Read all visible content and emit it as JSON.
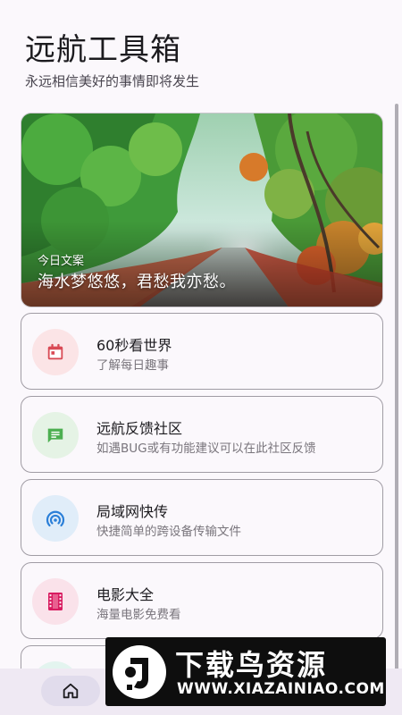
{
  "header": {
    "title": "远航工具箱",
    "subtitle": "永远相信美好的事情即将发生"
  },
  "hero": {
    "label": "今日文案",
    "quote": "海水梦悠悠，君愁我亦愁。"
  },
  "cards": [
    {
      "title": "60秒看世界",
      "desc": "了解每日趣事",
      "icon": "calendar-icon",
      "icon_color": "#d94a55",
      "icon_bg": "#fbe4e6"
    },
    {
      "title": "远航反馈社区",
      "desc": "如遇BUG或有功能建议可以在此社区反馈",
      "icon": "chat-message-icon",
      "icon_color": "#4caf50",
      "icon_bg": "#e5f3e5"
    },
    {
      "title": "局域网快传",
      "desc": "快捷简单的跨设备传输文件",
      "icon": "wifi-tethering-icon",
      "icon_color": "#2b7fd8",
      "icon_bg": "#e0edf9"
    },
    {
      "title": "电影大全",
      "desc": "海量电影免费看",
      "icon": "film-icon",
      "icon_color": "#d81b60",
      "icon_bg": "#fae2ea"
    }
  ],
  "nav": {
    "home_icon": "home-icon"
  },
  "watermark": {
    "title": "下载鸟资源",
    "url": "WWW.XIAZAINIAO.COM"
  }
}
